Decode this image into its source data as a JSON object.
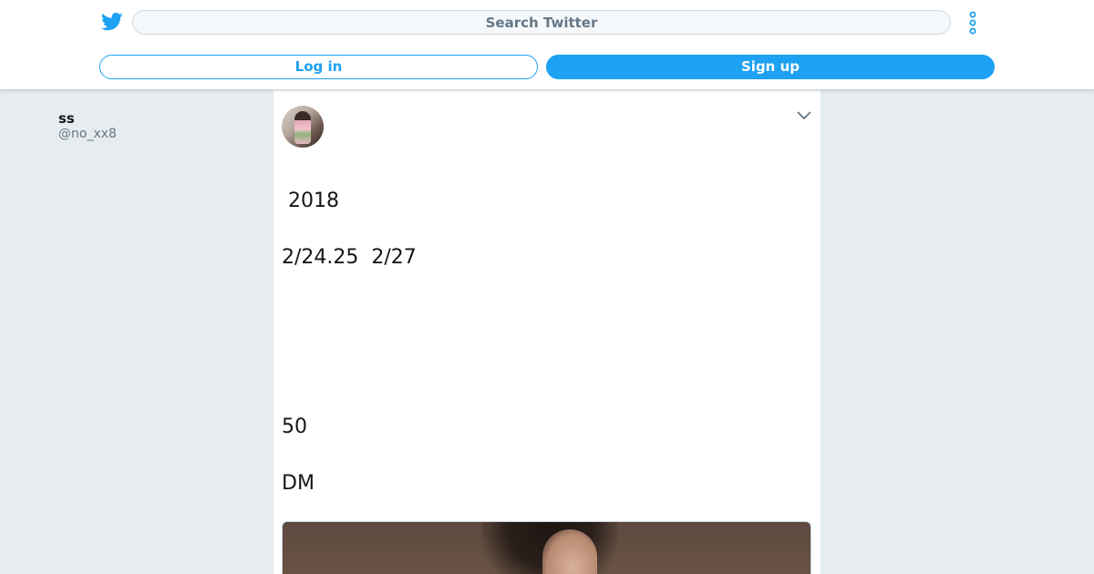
{
  "header": {
    "logo_icon": "twitter-bird-icon",
    "search_placeholder": "Search Twitter",
    "more_icon": "vertical-dots-icon",
    "login_label": "Log in",
    "signup_label": "Sign up"
  },
  "tweet": {
    "author_name": "ss",
    "author_handle": "@no_xx8",
    "menu_icon": "chevron-down-icon",
    "lines": [
      " 2018",
      "2/24.25  2/27",
      "50",
      "DM"
    ],
    "media_description_icon": "photo-image"
  },
  "colors": {
    "accent": "#1da1f2",
    "page_background": "#e6ecf0",
    "secondary_text": "#657786"
  }
}
